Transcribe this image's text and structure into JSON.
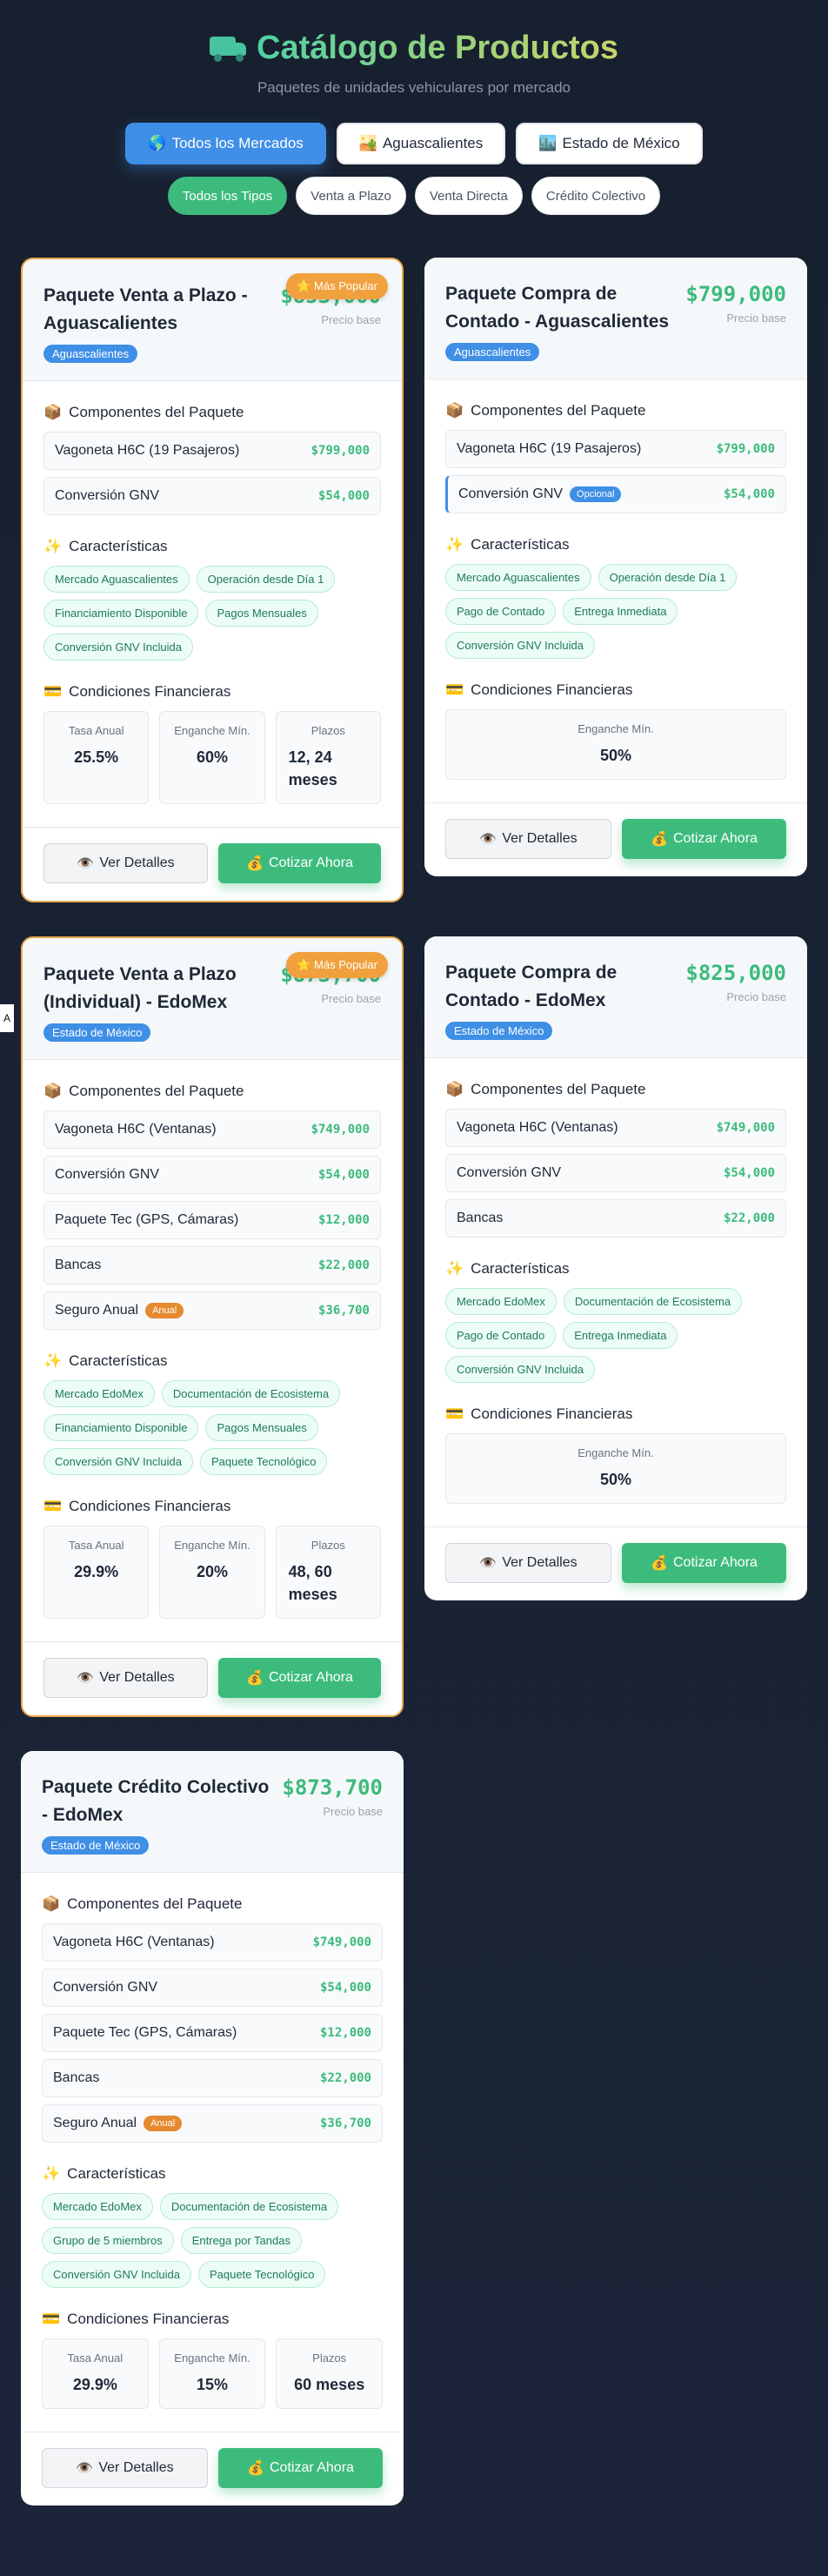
{
  "header": {
    "title": "Catálogo de Productos",
    "subtitle": "Paquetes de unidades vehiculares por mercado"
  },
  "market_filters": [
    {
      "icon": "🌎",
      "label": "Todos los Mercados"
    },
    {
      "icon": "🏜️",
      "label": "Aguascalientes"
    },
    {
      "icon": "🏙️",
      "label": "Estado de México"
    }
  ],
  "type_filters": [
    "Todos los Tipos",
    "Venta a Plazo",
    "Venta Directa",
    "Crédito Colectivo"
  ],
  "labels": {
    "price_note": "Precio base",
    "components": "Componentes del Paquete",
    "features": "Características",
    "financial": "Condiciones Financieras",
    "tasa": "Tasa Anual",
    "enganche": "Enganche Mín.",
    "plazos": "Plazos",
    "details_btn": "Ver Detalles",
    "quote_btn": "Cotizar Ahora",
    "popular": "⭐ Más Popular",
    "optional": "Opcional",
    "annual": "Anual",
    "edge_tab": "A"
  },
  "cards": [
    {
      "title": "Paquete Venta a Plazo - Aguascalientes",
      "price": "$853,000",
      "market": "Aguascalientes",
      "components": [
        {
          "name": "Vagoneta H6C (19 Pasajeros)",
          "price": "$799,000"
        },
        {
          "name": "Conversión GNV",
          "price": "$54,000"
        }
      ],
      "features": [
        "Mercado Aguascalientes",
        "Operación desde Día 1",
        "Financiamiento Disponible",
        "Pagos Mensuales",
        "Conversión GNV Incluida"
      ],
      "tasa": "25.5%",
      "enganche": "60%",
      "plazos": "12, 24 meses"
    },
    {
      "title": "Paquete Compra de Contado - Aguascalientes",
      "price": "$799,000",
      "market": "Aguascalientes",
      "components": [
        {
          "name": "Vagoneta H6C (19 Pasajeros)",
          "price": "$799,000"
        },
        {
          "name": "Conversión GNV",
          "price": "$54,000"
        }
      ],
      "features": [
        "Mercado Aguascalientes",
        "Operación desde Día 1",
        "Pago de Contado",
        "Entrega Inmediata",
        "Conversión GNV Incluida"
      ],
      "enganche": "50%"
    },
    {
      "title": "Paquete Venta a Plazo (Individual) - EdoMex",
      "price": "$873,700",
      "market": "Estado de México",
      "components": [
        {
          "name": "Vagoneta H6C (Ventanas)",
          "price": "$749,000"
        },
        {
          "name": "Conversión GNV",
          "price": "$54,000"
        },
        {
          "name": "Paquete Tec (GPS, Cámaras)",
          "price": "$12,000"
        },
        {
          "name": "Bancas",
          "price": "$22,000"
        },
        {
          "name": "Seguro Anual",
          "price": "$36,700"
        }
      ],
      "features": [
        "Mercado EdoMex",
        "Documentación de Ecosistema",
        "Financiamiento Disponible",
        "Pagos Mensuales",
        "Conversión GNV Incluida",
        "Paquete Tecnológico"
      ],
      "tasa": "29.9%",
      "enganche": "20%",
      "plazos": "48, 60 meses"
    },
    {
      "title": "Paquete Compra de Contado - EdoMex",
      "price": "$825,000",
      "market": "Estado de México",
      "components": [
        {
          "name": "Vagoneta H6C (Ventanas)",
          "price": "$749,000"
        },
        {
          "name": "Conversión GNV",
          "price": "$54,000"
        },
        {
          "name": "Bancas",
          "price": "$22,000"
        }
      ],
      "features": [
        "Mercado EdoMex",
        "Documentación de Ecosistema",
        "Pago de Contado",
        "Entrega Inmediata",
        "Conversión GNV Incluida"
      ],
      "enganche": "50%"
    },
    {
      "title": "Paquete Crédito Colectivo - EdoMex",
      "price": "$873,700",
      "market": "Estado de México",
      "components": [
        {
          "name": "Vagoneta H6C (Ventanas)",
          "price": "$749,000"
        },
        {
          "name": "Conversión GNV",
          "price": "$54,000"
        },
        {
          "name": "Paquete Tec (GPS, Cámaras)",
          "price": "$12,000"
        },
        {
          "name": "Bancas",
          "price": "$22,000"
        },
        {
          "name": "Seguro Anual",
          "price": "$36,700"
        }
      ],
      "features": [
        "Mercado EdoMex",
        "Documentación de Ecosistema",
        "Grupo de 5 miembros",
        "Entrega por Tandas",
        "Conversión GNV Incluida",
        "Paquete Tecnológico"
      ],
      "tasa": "29.9%",
      "enganche": "15%",
      "plazos": "60 meses"
    }
  ]
}
